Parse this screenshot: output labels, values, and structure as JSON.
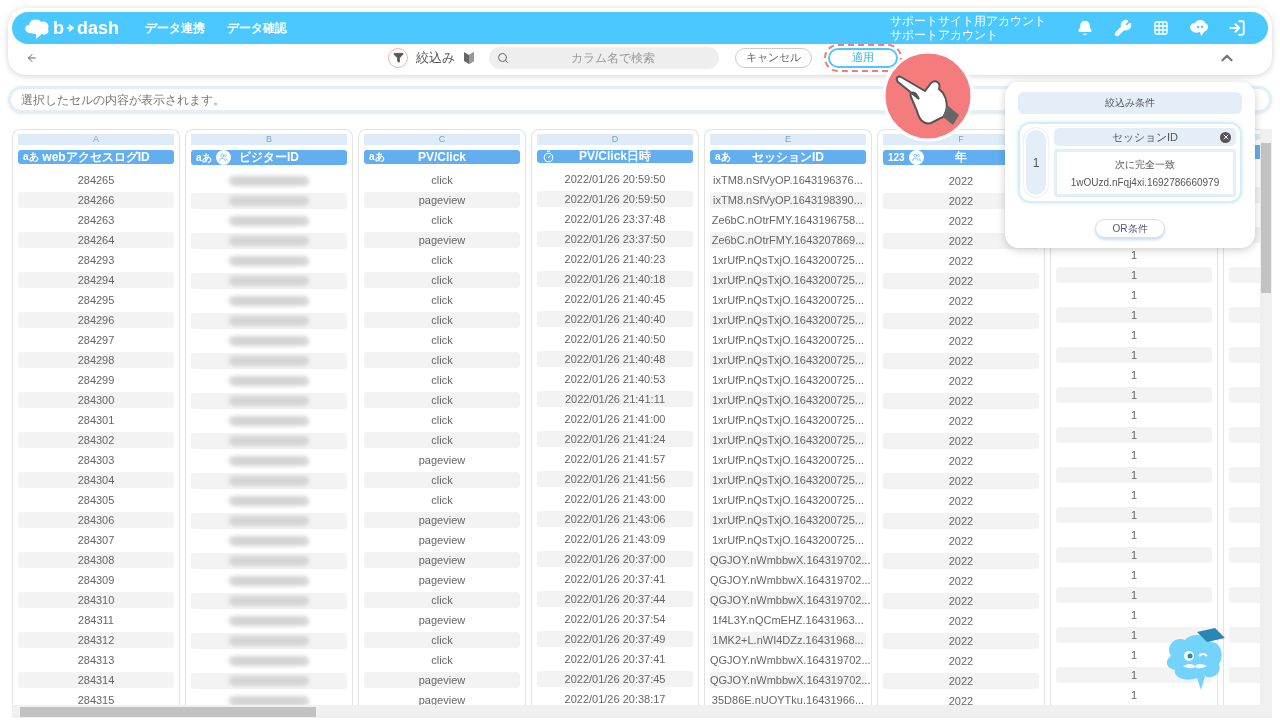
{
  "header": {
    "logo": [
      "b",
      "dash"
    ],
    "nav": [
      "データ連携",
      "データ確認"
    ],
    "account": [
      "サポートサイト用アカウント",
      "サポートアカウント"
    ]
  },
  "toolbar": {
    "filter_label": "絞込み",
    "search": {
      "placeholder": "カラム名で検索"
    },
    "buttons": [
      {
        "label": "キャンセル",
        "highlighted": false
      },
      {
        "label": "適用",
        "highlighted": true
      }
    ]
  },
  "cell_viewer": {
    "placeholder": "選択したセルの内容が表示されます。"
  },
  "columns": [
    {
      "letter": "A",
      "title": "webアクセスログID",
      "kind": "text",
      "type_mark": "aあ",
      "group": false,
      "values": [
        "284265",
        "284266",
        "284263",
        "284264",
        "284293",
        "284294",
        "284295",
        "284296",
        "284297",
        "284298",
        "284299",
        "284300",
        "284301",
        "284302",
        "284303",
        "284304",
        "284305",
        "284306",
        "284307",
        "284308",
        "284309",
        "284310",
        "284311",
        "284312",
        "284313",
        "284314",
        "284315"
      ]
    },
    {
      "letter": "B",
      "title": "ビジターID",
      "kind": "text",
      "type_mark": "aあ",
      "group": true,
      "blurred": true
    },
    {
      "letter": "C",
      "title": "PV/Click",
      "kind": "text",
      "type_mark": "aあ",
      "group": false,
      "values": [
        "click",
        "pageview",
        "click",
        "pageview",
        "click",
        "click",
        "click",
        "click",
        "click",
        "click",
        "click",
        "click",
        "click",
        "click",
        "pageview",
        "click",
        "click",
        "pageview",
        "pageview",
        "pageview",
        "pageview",
        "click",
        "pageview",
        "click",
        "click",
        "pageview",
        "pageview"
      ]
    },
    {
      "letter": "D",
      "title": "PV/Click日時",
      "kind": "datetime",
      "group": false,
      "values": [
        "2022/01/26 20:59:50",
        "2022/01/26 20:59:50",
        "2022/01/26 23:37:48",
        "2022/01/26 23:37:50",
        "2022/01/26 21:40:23",
        "2022/01/26 21:40:18",
        "2022/01/26 21:40:45",
        "2022/01/26 21:40:40",
        "2022/01/26 21:40:50",
        "2022/01/26 21:40:48",
        "2022/01/26 21:40:53",
        "2022/01/26 21:41:11",
        "2022/01/26 21:41:00",
        "2022/01/26 21:41:24",
        "2022/01/26 21:41:57",
        "2022/01/26 21:41:56",
        "2022/01/26 21:43:00",
        "2022/01/26 21:43:06",
        "2022/01/26 21:43:09",
        "2022/01/26 20:37:00",
        "2022/01/26 20:37:41",
        "2022/01/26 20:37:44",
        "2022/01/26 20:37:54",
        "2022/01/26 20:37:49",
        "2022/01/26 20:37:41",
        "2022/01/26 20:37:45",
        "2022/01/26 20:38:17"
      ]
    },
    {
      "letter": "E",
      "title": "セッションID",
      "kind": "text",
      "type_mark": "aあ",
      "group": false,
      "values": [
        "ixTM8.nSfVyOP.1643196376...",
        "ixTM8.nSfVyOP.1643198390...",
        "Ze6bC.nOtrFMY.1643196758...",
        "Ze6bC.nOtrFMY.1643207869...",
        "1xrUfP.nQsTxjO.1643200725...",
        "1xrUfP.nQsTxjO.1643200725...",
        "1xrUfP.nQsTxjO.1643200725...",
        "1xrUfP.nQsTxjO.1643200725...",
        "1xrUfP.nQsTxjO.1643200725...",
        "1xrUfP.nQsTxjO.1643200725...",
        "1xrUfP.nQsTxjO.1643200725...",
        "1xrUfP.nQsTxjO.1643200725...",
        "1xrUfP.nQsTxjO.1643200725...",
        "1xrUfP.nQsTxjO.1643200725...",
        "1xrUfP.nQsTxjO.1643200725...",
        "1xrUfP.nQsTxjO.1643200725...",
        "1xrUfP.nQsTxjO.1643200725...",
        "1xrUfP.nQsTxjO.1643200725...",
        "1xrUfP.nQsTxjO.1643200725...",
        "QGJOY.nWmbbwX.164319702...",
        "QGJOY.nWmbbwX.164319702...",
        "QGJOY.nWmbbwX.164319702...",
        "1f4L3Y.nQCmEHZ.16431963...",
        "1MK2+L.nWI4DZz.16431968...",
        "QGJOY.nWmbbwX.164319702...",
        "QGJOY.nWmbbwX.164319702...",
        "35D86E.nUOYTku.16431966..."
      ]
    },
    {
      "letter": "F",
      "title": "年",
      "kind": "number",
      "type_mark": "123",
      "group": true,
      "values": [
        "2022",
        "2022",
        "2022",
        "2022",
        "2022",
        "2022",
        "2022",
        "2022",
        "2022",
        "2022",
        "2022",
        "2022",
        "2022",
        "2022",
        "2022",
        "2022",
        "2022",
        "2022",
        "2022",
        "2022",
        "2022",
        "2022",
        "2022",
        "2022",
        "2022",
        "2022",
        "2022"
      ]
    },
    {
      "kind": "hidden",
      "values": [
        "1",
        "1",
        "1",
        "1",
        "1",
        "1",
        "1",
        "1",
        "1",
        "1",
        "1",
        "1",
        "1",
        "1",
        "1",
        "1",
        "1",
        "1",
        "1",
        "1",
        "1",
        "1",
        "1"
      ]
    }
  ],
  "filter_panel": {
    "title": "絞込み条件",
    "conditions": [
      {
        "number": "1",
        "column": "セッションID",
        "operator": "次に完全一致",
        "value": "1wOUzd.nFqj4xi.1692786660979"
      }
    ],
    "or_button": "OR条件"
  }
}
